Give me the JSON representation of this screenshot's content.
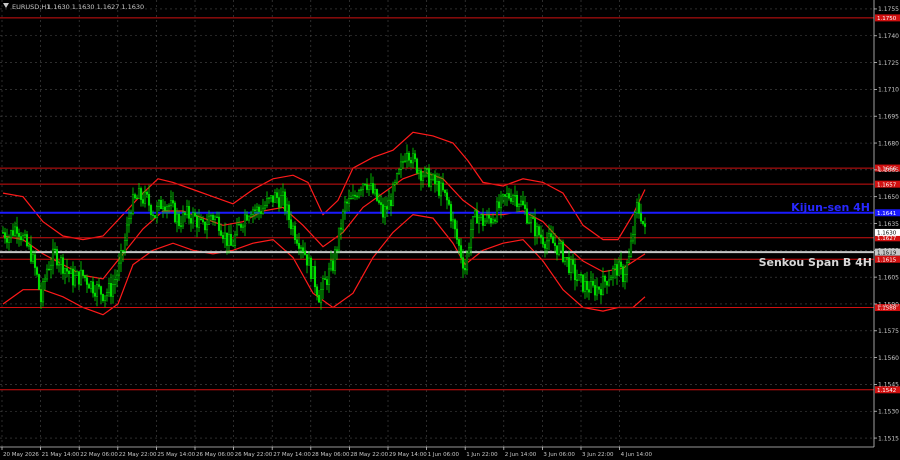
{
  "header": {
    "symbol": "EURUSD,H1",
    "ohlc": "1.1630 1.1630 1.1627 1.1630"
  },
  "colors": {
    "background": "#000000",
    "grid": "#4a4a4a",
    "bull": "#00e000",
    "bear": "#00e000",
    "bollinger": "#ff1a1a",
    "level": "#d01010",
    "kijun": "#1a1aff",
    "senkou": "#c8c8c8",
    "axis_text": "#c8c8c8"
  },
  "chart_data": {
    "type": "candlestick",
    "y_range": [
      1.151,
      1.176
    ],
    "y_ticks": [
      "1.1755",
      "1.1740",
      "1.1725",
      "1.1710",
      "1.1695",
      "1.1680",
      "1.1665",
      "1.1650",
      "1.1635",
      "1.1620",
      "1.1605",
      "1.1590",
      "1.1575",
      "1.1560",
      "1.1545",
      "1.1530",
      "1.1515"
    ],
    "x_ticks": [
      "20 May 2026",
      "21 May 14:00",
      "22 May 06:00",
      "22 May 22:00",
      "25 May 14:00",
      "26 May 06:00",
      "26 May 22:00",
      "27 May 14:00",
      "28 May 06:00",
      "28 May 22:00",
      "29 May 14:00",
      "1 Jun 06:00",
      "1 Jun 22:00",
      "2 Jun 14:00",
      "3 Jun 06:00",
      "3 Jun 22:00",
      "4 Jun 14:00"
    ],
    "levels": [
      {
        "price": 1.175,
        "label": "1.1750",
        "kind": "resistance"
      },
      {
        "price": 1.1666,
        "label": "1.1666",
        "kind": "resistance"
      },
      {
        "price": 1.1657,
        "label": "1.1657",
        "kind": "resistance"
      },
      {
        "price": 1.1627,
        "label": "1.1627",
        "kind": "resistance"
      },
      {
        "price": 1.1615,
        "label": "1.1615",
        "kind": "resistance"
      },
      {
        "price": 1.1588,
        "label": "1.1588",
        "kind": "support"
      },
      {
        "price": 1.1542,
        "label": "1.1542",
        "kind": "support"
      }
    ],
    "kijun": {
      "price": 1.1641,
      "label": "Kijun-sen 4H",
      "axis_label": "1.1641"
    },
    "senkou": {
      "price": 1.1619,
      "label": "Senkou Span B 4H",
      "axis_label": "1.1619"
    },
    "current_price": {
      "price": 1.163,
      "label": "1.1630"
    },
    "close_path": [
      [
        0,
        1.163
      ],
      [
        6,
        1.1628
      ],
      [
        14,
        1.1634
      ],
      [
        22,
        1.1624
      ],
      [
        28,
        1.1618
      ],
      [
        34,
        1.1605
      ],
      [
        38,
        1.1592
      ],
      [
        44,
        1.161
      ],
      [
        52,
        1.1618
      ],
      [
        60,
        1.1612
      ],
      [
        70,
        1.1604
      ],
      [
        80,
        1.1606
      ],
      [
        90,
        1.16
      ],
      [
        100,
        1.1596
      ],
      [
        108,
        1.1598
      ],
      [
        116,
        1.161
      ],
      [
        122,
        1.1625
      ],
      [
        128,
        1.1645
      ],
      [
        136,
        1.165
      ],
      [
        144,
        1.1648
      ],
      [
        152,
        1.164
      ],
      [
        160,
        1.1648
      ],
      [
        168,
        1.1644
      ],
      [
        176,
        1.1636
      ],
      [
        184,
        1.164
      ],
      [
        192,
        1.1638
      ],
      [
        200,
        1.1632
      ],
      [
        208,
        1.164
      ],
      [
        216,
        1.1636
      ],
      [
        222,
        1.1628
      ],
      [
        228,
        1.1622
      ],
      [
        234,
        1.163
      ],
      [
        240,
        1.1638
      ],
      [
        248,
        1.1644
      ],
      [
        256,
        1.1642
      ],
      [
        264,
        1.1646
      ],
      [
        272,
        1.165
      ],
      [
        280,
        1.1648
      ],
      [
        286,
        1.1638
      ],
      [
        292,
        1.163
      ],
      [
        300,
        1.1622
      ],
      [
        306,
        1.1612
      ],
      [
        310,
        1.1606
      ],
      [
        316,
        1.1595
      ],
      [
        322,
        1.1602
      ],
      [
        330,
        1.1612
      ],
      [
        336,
        1.1628
      ],
      [
        342,
        1.1645
      ],
      [
        350,
        1.1648
      ],
      [
        356,
        1.1656
      ],
      [
        362,
        1.166
      ],
      [
        368,
        1.1654
      ],
      [
        374,
        1.1648
      ],
      [
        380,
        1.164
      ],
      [
        386,
        1.1646
      ],
      [
        392,
        1.1655
      ],
      [
        398,
        1.1666
      ],
      [
        404,
        1.1678
      ],
      [
        410,
        1.167
      ],
      [
        418,
        1.1664
      ],
      [
        426,
        1.166
      ],
      [
        434,
        1.1656
      ],
      [
        440,
        1.1652
      ],
      [
        446,
        1.1645
      ],
      [
        452,
        1.163
      ],
      [
        458,
        1.1618
      ],
      [
        462,
        1.161
      ],
      [
        468,
        1.1632
      ],
      [
        474,
        1.164
      ],
      [
        480,
        1.1636
      ],
      [
        488,
        1.1638
      ],
      [
        496,
        1.1644
      ],
      [
        504,
        1.165
      ],
      [
        510,
        1.1652
      ],
      [
        516,
        1.1648
      ],
      [
        522,
        1.1642
      ],
      [
        528,
        1.1636
      ],
      [
        534,
        1.163
      ],
      [
        542,
        1.1626
      ],
      [
        550,
        1.1624
      ],
      [
        558,
        1.162
      ],
      [
        566,
        1.1612
      ],
      [
        574,
        1.1604
      ],
      [
        582,
        1.16
      ],
      [
        590,
        1.1598
      ],
      [
        598,
        1.16
      ],
      [
        606,
        1.1606
      ],
      [
        614,
        1.161
      ],
      [
        620,
        1.1606
      ],
      [
        626,
        1.1615
      ],
      [
        630,
        1.163
      ],
      [
        634,
        1.1644
      ],
      [
        638,
        1.164
      ],
      [
        642,
        1.163
      ]
    ],
    "upper_band": [
      [
        0,
        1.1652
      ],
      [
        20,
        1.165
      ],
      [
        40,
        1.1636
      ],
      [
        60,
        1.1628
      ],
      [
        80,
        1.1626
      ],
      [
        100,
        1.1628
      ],
      [
        120,
        1.164
      ],
      [
        140,
        1.1652
      ],
      [
        155,
        1.166
      ],
      [
        170,
        1.1658
      ],
      [
        190,
        1.1654
      ],
      [
        210,
        1.165
      ],
      [
        230,
        1.1646
      ],
      [
        250,
        1.1654
      ],
      [
        270,
        1.166
      ],
      [
        290,
        1.1662
      ],
      [
        305,
        1.1658
      ],
      [
        320,
        1.164
      ],
      [
        335,
        1.1648
      ],
      [
        350,
        1.1666
      ],
      [
        370,
        1.1672
      ],
      [
        390,
        1.1676
      ],
      [
        410,
        1.1686
      ],
      [
        430,
        1.1684
      ],
      [
        450,
        1.168
      ],
      [
        465,
        1.167
      ],
      [
        480,
        1.1658
      ],
      [
        500,
        1.1656
      ],
      [
        520,
        1.166
      ],
      [
        540,
        1.1658
      ],
      [
        560,
        1.1652
      ],
      [
        580,
        1.1634
      ],
      [
        600,
        1.1626
      ],
      [
        615,
        1.1626
      ],
      [
        630,
        1.164
      ],
      [
        642,
        1.1654
      ]
    ],
    "middle_band": [
      [
        0,
        1.1628
      ],
      [
        20,
        1.1626
      ],
      [
        40,
        1.1618
      ],
      [
        60,
        1.1612
      ],
      [
        80,
        1.1606
      ],
      [
        100,
        1.1604
      ],
      [
        120,
        1.1618
      ],
      [
        140,
        1.1632
      ],
      [
        160,
        1.1642
      ],
      [
        180,
        1.1642
      ],
      [
        200,
        1.1638
      ],
      [
        220,
        1.1634
      ],
      [
        240,
        1.1636
      ],
      [
        260,
        1.1642
      ],
      [
        280,
        1.1644
      ],
      [
        300,
        1.1634
      ],
      [
        320,
        1.1622
      ],
      [
        340,
        1.163
      ],
      [
        360,
        1.1644
      ],
      [
        380,
        1.1652
      ],
      [
        400,
        1.166
      ],
      [
        420,
        1.1664
      ],
      [
        440,
        1.166
      ],
      [
        460,
        1.1648
      ],
      [
        480,
        1.164
      ],
      [
        500,
        1.164
      ],
      [
        520,
        1.1642
      ],
      [
        540,
        1.1636
      ],
      [
        560,
        1.1624
      ],
      [
        580,
        1.1614
      ],
      [
        600,
        1.1608
      ],
      [
        620,
        1.161
      ],
      [
        642,
        1.1618
      ]
    ],
    "lower_band": [
      [
        0,
        1.159
      ],
      [
        20,
        1.1598
      ],
      [
        40,
        1.1598
      ],
      [
        60,
        1.1594
      ],
      [
        80,
        1.1588
      ],
      [
        100,
        1.1584
      ],
      [
        115,
        1.159
      ],
      [
        130,
        1.1612
      ],
      [
        150,
        1.162
      ],
      [
        170,
        1.1624
      ],
      [
        190,
        1.162
      ],
      [
        210,
        1.1618
      ],
      [
        230,
        1.162
      ],
      [
        250,
        1.1624
      ],
      [
        270,
        1.1626
      ],
      [
        290,
        1.1616
      ],
      [
        310,
        1.1596
      ],
      [
        330,
        1.1588
      ],
      [
        350,
        1.1596
      ],
      [
        370,
        1.1616
      ],
      [
        390,
        1.163
      ],
      [
        410,
        1.164
      ],
      [
        430,
        1.1638
      ],
      [
        450,
        1.1624
      ],
      [
        462,
        1.1612
      ],
      [
        480,
        1.162
      ],
      [
        500,
        1.1624
      ],
      [
        520,
        1.1626
      ],
      [
        540,
        1.1614
      ],
      [
        560,
        1.1598
      ],
      [
        580,
        1.1588
      ],
      [
        600,
        1.1586
      ],
      [
        615,
        1.1588
      ],
      [
        630,
        1.1588
      ],
      [
        642,
        1.1594
      ]
    ]
  }
}
